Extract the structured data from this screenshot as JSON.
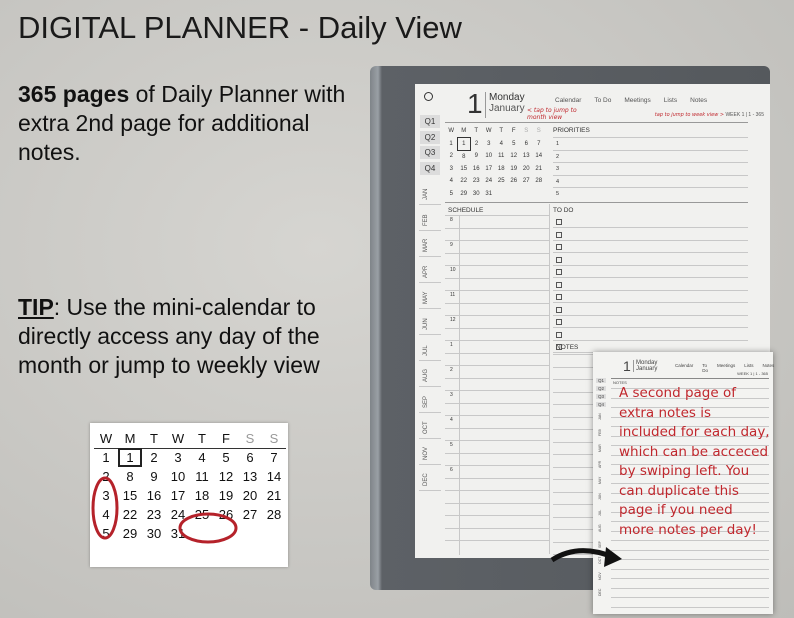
{
  "title": {
    "main": "DIGITAL PLANNER",
    "sub": " - Daily View"
  },
  "intro": {
    "bold": "365 pages",
    "rest": " of Daily Planner with extra 2nd page for additional notes."
  },
  "tip": {
    "label": "TIP",
    "rest": ": Use the mini-calendar to directly access any day of the month or jump to weekly view"
  },
  "planner": {
    "day": "1",
    "weekday": "Monday",
    "month": "January",
    "nav": [
      "Calendar",
      "To Do",
      "Meetings",
      "Lists",
      "Notes"
    ],
    "week_label": "WEEK 1 | 1 - 365",
    "annot_month": "< tap to jump to month view",
    "annot_week": "tap to jump to week view >",
    "quarters": [
      "Q1",
      "Q2",
      "Q3",
      "Q4"
    ],
    "months": [
      "JAN",
      "FEB",
      "MAR",
      "APR",
      "MAY",
      "JUN",
      "JUL",
      "AUG",
      "SEP",
      "OCT",
      "NOV",
      "DEC"
    ],
    "cal_head": [
      "W",
      "M",
      "T",
      "W",
      "T",
      "F",
      "S",
      "S"
    ],
    "cal_rows": [
      [
        "1",
        "1",
        "2",
        "3",
        "4",
        "5",
        "6",
        "7"
      ],
      [
        "2",
        "8",
        "9",
        "10",
        "11",
        "12",
        "13",
        "14"
      ],
      [
        "3",
        "15",
        "16",
        "17",
        "18",
        "19",
        "20",
        "21"
      ],
      [
        "4",
        "22",
        "23",
        "24",
        "25",
        "26",
        "27",
        "28"
      ],
      [
        "5",
        "29",
        "30",
        "31",
        "",
        "",
        "",
        ""
      ]
    ],
    "priorities_label": "PRIORITIES",
    "priorities": [
      "1",
      "2",
      "3",
      "4",
      "5"
    ],
    "schedule_label": "SCHEDULE",
    "hours": [
      "8",
      "9",
      "10",
      "11",
      "12",
      "1",
      "2",
      "3",
      "4",
      "5",
      "6"
    ],
    "todo_label": "TO DO",
    "notes_label": "NOTES"
  },
  "page2": {
    "notes_label": "NOTES",
    "annotation": "A second page of extra notes is included for each day, which can be acceced by swiping left. You can duplicate this page if you need more notes per day!"
  },
  "inset": {
    "head": [
      "W",
      "M",
      "T",
      "W",
      "T",
      "F",
      "S",
      "S"
    ],
    "rows": [
      [
        "1",
        "1",
        "2",
        "3",
        "4",
        "5",
        "6",
        "7"
      ],
      [
        "2",
        "8",
        "9",
        "10",
        "11",
        "12",
        "13",
        "14"
      ],
      [
        "3",
        "15",
        "16",
        "17",
        "18",
        "19",
        "20",
        "21"
      ],
      [
        "4",
        "22",
        "23",
        "24",
        "25",
        "26",
        "27",
        "28"
      ],
      [
        "5",
        "29",
        "30",
        "31",
        "",
        "",
        "",
        ""
      ]
    ]
  },
  "colors": {
    "annotation": "#c0272d",
    "background": "#c9c8c4",
    "device_frame": "#55595d"
  }
}
